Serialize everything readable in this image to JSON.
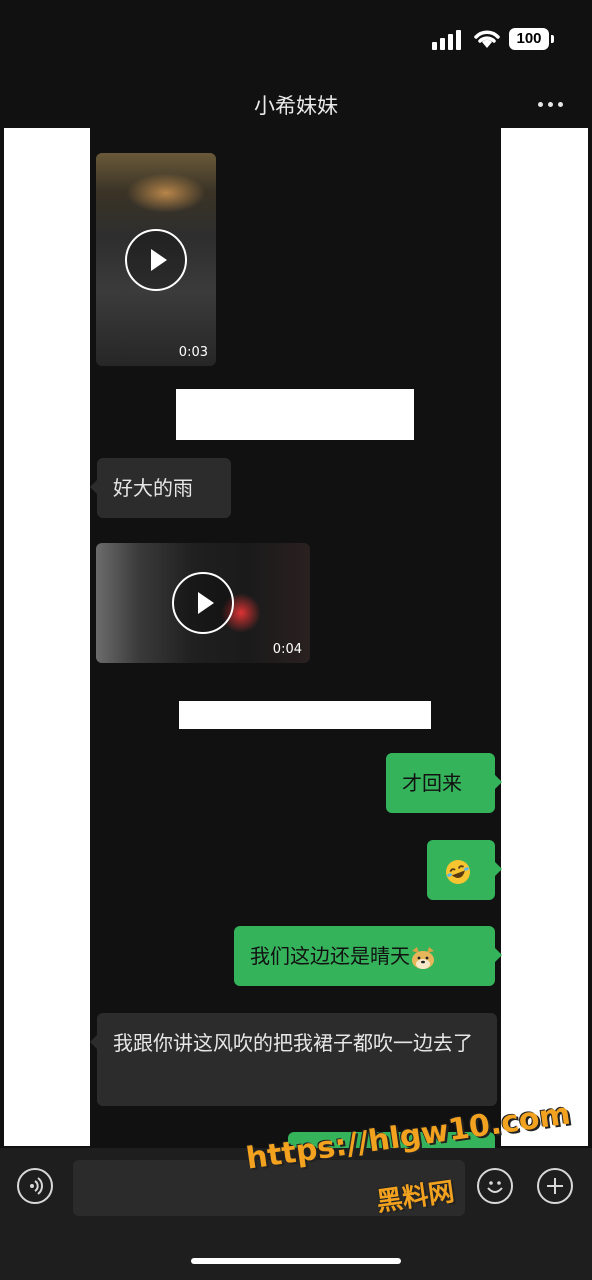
{
  "status": {
    "battery": "100"
  },
  "header": {
    "title": "小希妹妹",
    "more_icon": "more-dots-icon"
  },
  "messages": [
    {
      "type": "video",
      "side": "in",
      "duration": "0:03"
    },
    {
      "type": "text",
      "side": "in",
      "text": "好大的雨"
    },
    {
      "type": "video",
      "side": "in",
      "duration": "0:04"
    },
    {
      "type": "text",
      "side": "out",
      "text": "才回来"
    },
    {
      "type": "emoji",
      "side": "out",
      "emoji": "rofl-emoji"
    },
    {
      "type": "text",
      "side": "out",
      "text": "我们这边还是晴天"
    },
    {
      "type": "text",
      "side": "in",
      "text": "我跟你讲这风吹的把我裙子都吹一边去了"
    },
    {
      "type": "text",
      "side": "out",
      "text": ""
    }
  ],
  "input_bar": {
    "placeholder": ""
  },
  "watermark": {
    "url": "https://hlgw10.com",
    "name": "黑料网"
  },
  "colors": {
    "outgoing": "#35b35b",
    "incoming": "#2c2c2c",
    "background": "#111111"
  }
}
